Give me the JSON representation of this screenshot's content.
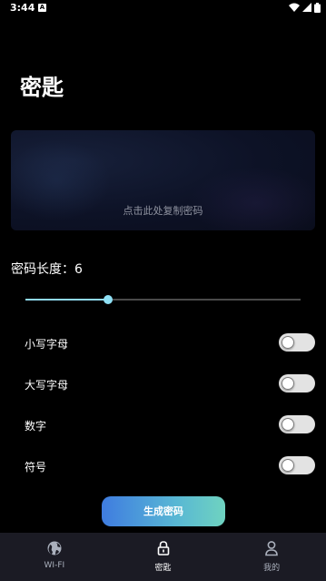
{
  "status_bar": {
    "time": "3:44",
    "notification_icon": "a-icon",
    "icons": [
      "wifi-icon",
      "signal-icon",
      "battery-icon"
    ]
  },
  "page": {
    "title": "密匙"
  },
  "password_card": {
    "hint": "点击此处复制密码"
  },
  "length": {
    "label": "密码长度：6",
    "value": 6,
    "slider_fraction": 0.3
  },
  "options": [
    {
      "label": "小写字母",
      "enabled": false
    },
    {
      "label": "大写字母",
      "enabled": false
    },
    {
      "label": "数字",
      "enabled": false
    },
    {
      "label": "符号",
      "enabled": false
    }
  ],
  "generate_button": {
    "label": "生成密码",
    "gradient_start": "#3f7ce0",
    "gradient_end": "#6fd3c0"
  },
  "bottom_nav": {
    "items": [
      {
        "label": "WI-FI",
        "icon": "globe-icon",
        "active": false
      },
      {
        "label": "密匙",
        "icon": "lock-icon",
        "active": true
      },
      {
        "label": "我的",
        "icon": "person-icon",
        "active": false
      }
    ]
  },
  "colors": {
    "background": "#000000",
    "accent": "#8fe0f5",
    "nav_background": "#1b1b24"
  }
}
